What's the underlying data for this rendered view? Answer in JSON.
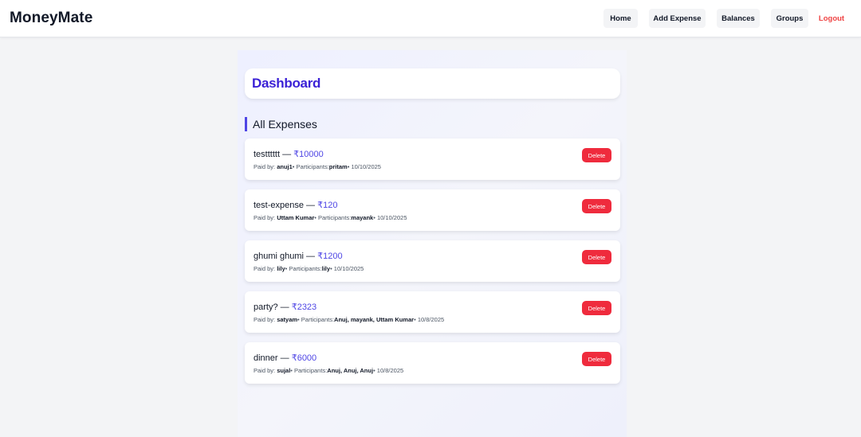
{
  "brand": "MoneyMate",
  "nav": {
    "home": "Home",
    "add_expense": "Add Expense",
    "balances": "Balances",
    "groups": "Groups",
    "logout": "Logout"
  },
  "dashboard": {
    "title": "Dashboard",
    "section_title": "All Expenses"
  },
  "labels": {
    "dash": " — ",
    "paid_by": "Paid by: ",
    "bullet": "•",
    "participants": " Participants:",
    "delete": "Delete"
  },
  "expenses": [
    {
      "title": "testttttt",
      "amount": "₹10000",
      "paid_by": "anuj1",
      "participants": "pritam",
      "date": "10/10/2025"
    },
    {
      "title": "test-expense",
      "amount": "₹120",
      "paid_by": "Uttam Kumar",
      "participants": "mayank",
      "date": "10/10/2025"
    },
    {
      "title": "ghumi ghumi",
      "amount": "₹1200",
      "paid_by": "lily",
      "participants": "lily",
      "date": "10/10/2025"
    },
    {
      "title": "party?",
      "amount": "₹2323",
      "paid_by": "satyam",
      "participants": "Anuj, mayank, Uttam Kumar",
      "date": "10/8/2025"
    },
    {
      "title": "dinner",
      "amount": "₹6000",
      "paid_by": "sujal",
      "participants": "Anuj, Anuj, Anuj",
      "date": "10/8/2025"
    }
  ],
  "colors": {
    "accent": "#4f46e5",
    "title": "#3b21d6",
    "danger": "#ef2b3d",
    "logout": "#ef4444"
  }
}
